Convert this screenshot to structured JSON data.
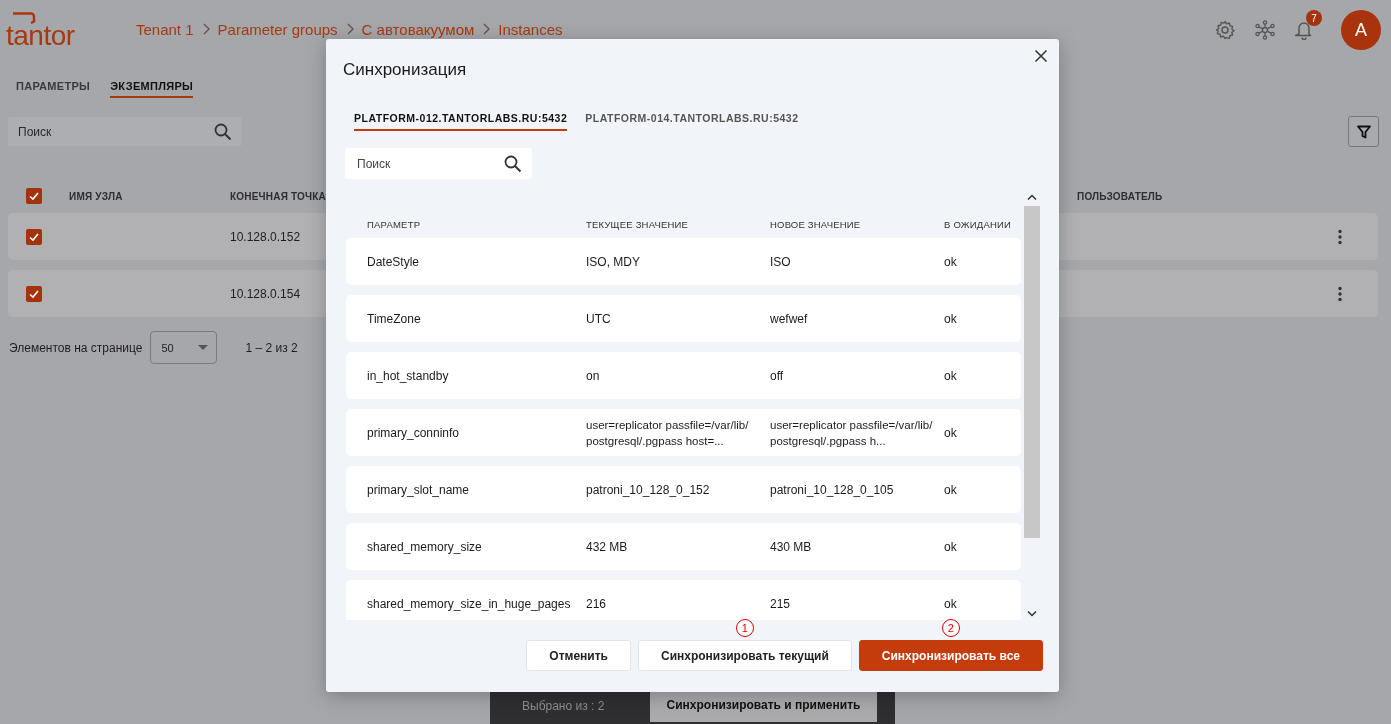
{
  "header": {
    "logo": "tantor",
    "breadcrumbs": [
      "Tenant 1",
      "Parameter groups",
      "С автовакуумом",
      "Instances"
    ],
    "notifications_badge": "7",
    "avatar": "A"
  },
  "tabs": [
    {
      "label": "ПАРАМЕТРЫ",
      "selected": false
    },
    {
      "label": "ЭКЗЕМПЛЯРЫ",
      "selected": true
    }
  ],
  "search": {
    "placeholder": "Поиск"
  },
  "table": {
    "select_all_checked": true,
    "columns": [
      "ИМЯ УЗЛА",
      "КОНЕЧНАЯ ТОЧКА",
      "ПОЛЬЗОВАТЕЛЬ"
    ],
    "rows": [
      {
        "checked": true,
        "endpoint": "10.128.0.152"
      },
      {
        "checked": true,
        "endpoint": "10.128.0.154"
      }
    ]
  },
  "pagination": {
    "label": "Элементов на странице",
    "page_size": "50",
    "range": "1 – 2 из 2"
  },
  "selection_bar": {
    "label": "Выбрано из : 2",
    "button": "Синхронизировать и применить"
  },
  "dialog": {
    "title": "Синхронизация",
    "tabs": [
      {
        "label": "PLATFORM-012.TANTORLABS.RU:5432",
        "selected": true
      },
      {
        "label": "PLATFORM-014.TANTORLABS.RU:5432",
        "selected": false
      }
    ],
    "search": {
      "placeholder": "Поиск"
    },
    "columns": [
      "ПАРАМЕТР",
      "ТЕКУЩЕЕ ЗНАЧЕНИЕ",
      "НОВОЕ ЗНАЧЕНИЕ",
      "В ОЖИДАНИИ"
    ],
    "rows": [
      {
        "parameter": "DateStyle",
        "current": "ISO, MDY",
        "new": "ISO",
        "pending": "ok"
      },
      {
        "parameter": "TimeZone",
        "current": "UTC",
        "new": "wefwef",
        "pending": "ok"
      },
      {
        "parameter": "in_hot_standby",
        "current": "on",
        "new": "off",
        "pending": "ok"
      },
      {
        "parameter": "primary_conninfo",
        "current": "user=replicator passfile=/var/lib/postgresql/.pgpass host=...",
        "new": "user=replicator passfile=/var/lib/postgresql/.pgpass h...",
        "pending": "ok"
      },
      {
        "parameter": "primary_slot_name",
        "current": "patroni_10_128_0_152",
        "new": "patroni_10_128_0_105",
        "pending": "ok"
      },
      {
        "parameter": "shared_memory_size",
        "current": "432 MB",
        "new": "430 MB",
        "pending": "ok"
      },
      {
        "parameter": "shared_memory_size_in_huge_pages",
        "current": "216",
        "new": "215",
        "pending": "ok"
      }
    ],
    "buttons": [
      {
        "label": "Отменить",
        "kind": "secondary"
      },
      {
        "label": "Синхронизировать текущий",
        "kind": "secondary",
        "annotation": "1"
      },
      {
        "label": "Синхронизировать все",
        "kind": "primary",
        "annotation": "2"
      }
    ]
  }
}
